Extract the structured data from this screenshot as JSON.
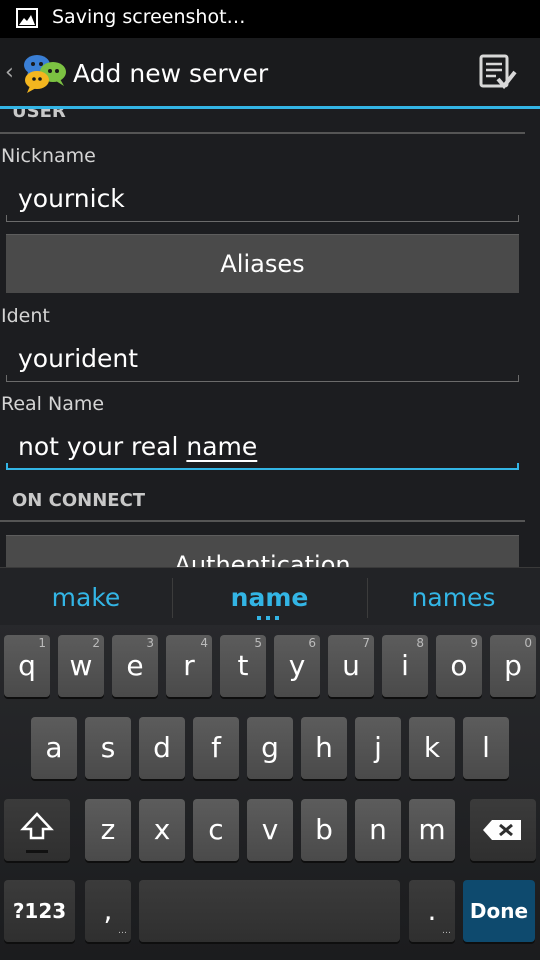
{
  "status_bar": {
    "text": "Saving screenshot…",
    "icon": "image-icon"
  },
  "action_bar": {
    "title": "Add new server",
    "up_caret": "‹",
    "save_icon": "checklist-save-icon"
  },
  "form": {
    "user_section_title": "USER",
    "nickname_label": "Nickname",
    "nickname_value": "yournick",
    "aliases_button": "Aliases",
    "ident_label": "Ident",
    "ident_value": "yourident",
    "realname_label": "Real Name",
    "realname_prefix": "not your real ",
    "realname_composing": "name",
    "on_connect_title": "ON CONNECT",
    "authentication_button": "Authentication"
  },
  "keyboard": {
    "suggestions": [
      "make",
      "name",
      "names"
    ],
    "row1": [
      {
        "label": "q",
        "hint": "1"
      },
      {
        "label": "w",
        "hint": "2"
      },
      {
        "label": "e",
        "hint": "3"
      },
      {
        "label": "r",
        "hint": "4"
      },
      {
        "label": "t",
        "hint": "5"
      },
      {
        "label": "y",
        "hint": "6"
      },
      {
        "label": "u",
        "hint": "7"
      },
      {
        "label": "i",
        "hint": "8"
      },
      {
        "label": "o",
        "hint": "9"
      },
      {
        "label": "p",
        "hint": "0"
      }
    ],
    "row2": [
      "a",
      "s",
      "d",
      "f",
      "g",
      "h",
      "j",
      "k",
      "l"
    ],
    "row3": [
      "z",
      "x",
      "c",
      "v",
      "b",
      "n",
      "m"
    ],
    "symbols_key": "?123",
    "comma_key": ",",
    "period_key": ".",
    "done_key": "Done",
    "accent_color": "#33b5e5"
  }
}
